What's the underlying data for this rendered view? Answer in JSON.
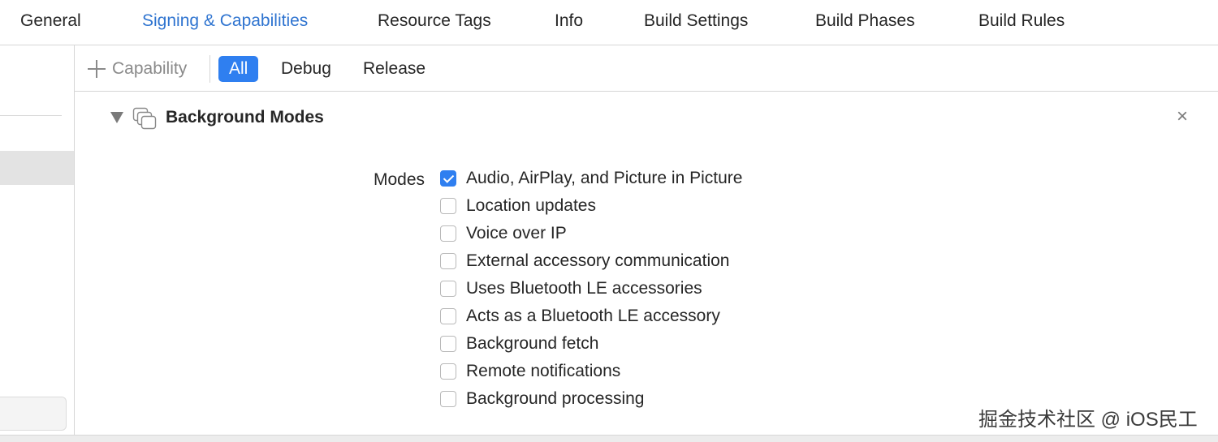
{
  "tabs": [
    {
      "label": "General",
      "active": false
    },
    {
      "label": "Signing & Capabilities",
      "active": true
    },
    {
      "label": "Resource Tags",
      "active": false
    },
    {
      "label": "Info",
      "active": false
    },
    {
      "label": "Build Settings",
      "active": false
    },
    {
      "label": "Build Phases",
      "active": false
    },
    {
      "label": "Build Rules",
      "active": false
    }
  ],
  "toolbar": {
    "add_capability_label": "Capability",
    "add_icon": "plus-icon",
    "filters": [
      {
        "label": "All",
        "active": true
      },
      {
        "label": "Debug",
        "active": false
      },
      {
        "label": "Release",
        "active": false
      }
    ]
  },
  "capability": {
    "title": "Background Modes",
    "icon": "stacked-windows-icon",
    "expanded": true,
    "close_icon": "close-icon",
    "close_glyph": "×",
    "modes_label": "Modes",
    "modes": [
      {
        "label": "Audio, AirPlay, and Picture in Picture",
        "checked": true
      },
      {
        "label": "Location updates",
        "checked": false
      },
      {
        "label": "Voice over IP",
        "checked": false
      },
      {
        "label": "External accessory communication",
        "checked": false
      },
      {
        "label": "Uses Bluetooth LE accessories",
        "checked": false
      },
      {
        "label": "Acts as a Bluetooth LE accessory",
        "checked": false
      },
      {
        "label": "Background fetch",
        "checked": false
      },
      {
        "label": "Remote notifications",
        "checked": false
      },
      {
        "label": "Background processing",
        "checked": false
      }
    ]
  },
  "watermark": "掘金技术社区 @ iOS民工",
  "colors": {
    "accent": "#2f7ff0",
    "active_tab_text": "#2f74d0"
  }
}
